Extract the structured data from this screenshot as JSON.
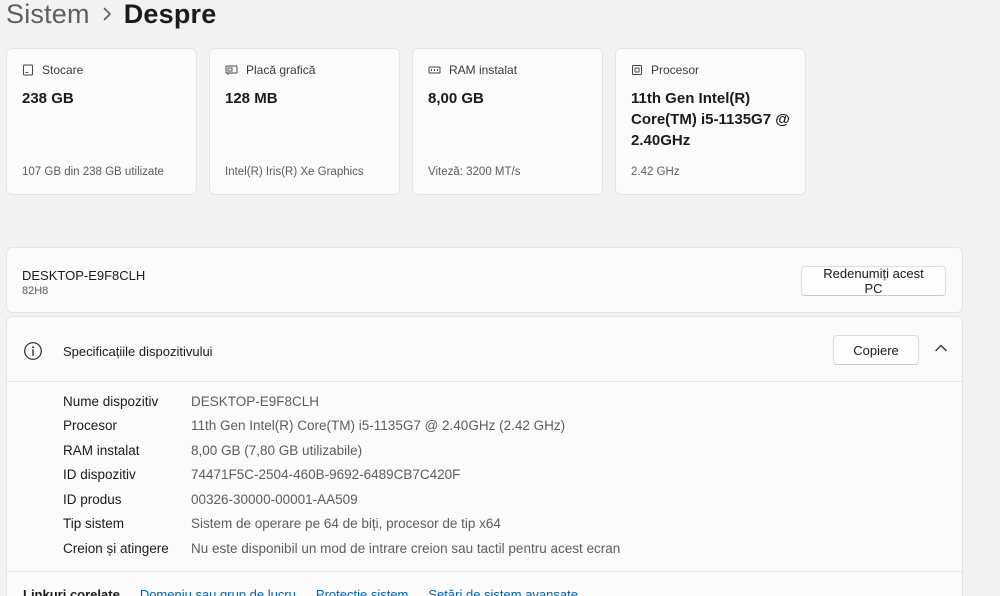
{
  "breadcrumb": {
    "parent": "Sistem",
    "current": "Despre"
  },
  "cards": [
    {
      "icon": "storage-icon",
      "label": "Stocare",
      "value": "238 GB",
      "sub": "107 GB din 238 GB utilizate"
    },
    {
      "icon": "gpu-icon",
      "label": "Placă grafică",
      "value": "128 MB",
      "sub": "Intel(R) Iris(R) Xe Graphics"
    },
    {
      "icon": "ram-icon",
      "label": "RAM instalat",
      "value": "8,00 GB",
      "sub": "Viteză: 3200 MT/s"
    },
    {
      "icon": "processor-icon",
      "label": "Procesor",
      "value": "11th Gen Intel(R) Core(TM) i5-1135G7 @ 2.40GHz",
      "sub": "2.42 GHz"
    }
  ],
  "device": {
    "name": "DESKTOP-E9F8CLH",
    "model": "82H8",
    "rename_button": "Redenumiți acest PC"
  },
  "specs": {
    "title": "Specificațiile dispozitivului",
    "copy_button": "Copiere",
    "rows": [
      {
        "label": "Nume dispozitiv",
        "value": "DESKTOP-E9F8CLH"
      },
      {
        "label": "Procesor",
        "value": "11th Gen Intel(R) Core(TM) i5-1135G7 @ 2.40GHz (2.42 GHz)"
      },
      {
        "label": "RAM instalat",
        "value": "8,00 GB (7,80 GB utilizabile)"
      },
      {
        "label": "ID dispozitiv",
        "value": "74471F5C-2504-460B-9692-6489CB7C420F"
      },
      {
        "label": "ID produs",
        "value": "00326-30000-00001-AA509"
      },
      {
        "label": "Tip sistem",
        "value": "Sistem de operare pe 64 de biți, procesor de tip x64"
      },
      {
        "label": "Creion și atingere",
        "value": "Nu este disponibil un mod de intrare creion sau tactil pentru acest ecran"
      }
    ]
  },
  "related": {
    "label": "Linkuri corelate",
    "links": [
      "Domeniu sau grup de lucru",
      "Protecție sistem",
      "Setări de sistem avansate"
    ]
  },
  "colors": {
    "accent": "#005fb8",
    "background": "#f3f3f3",
    "card": "#fbfbfb"
  }
}
